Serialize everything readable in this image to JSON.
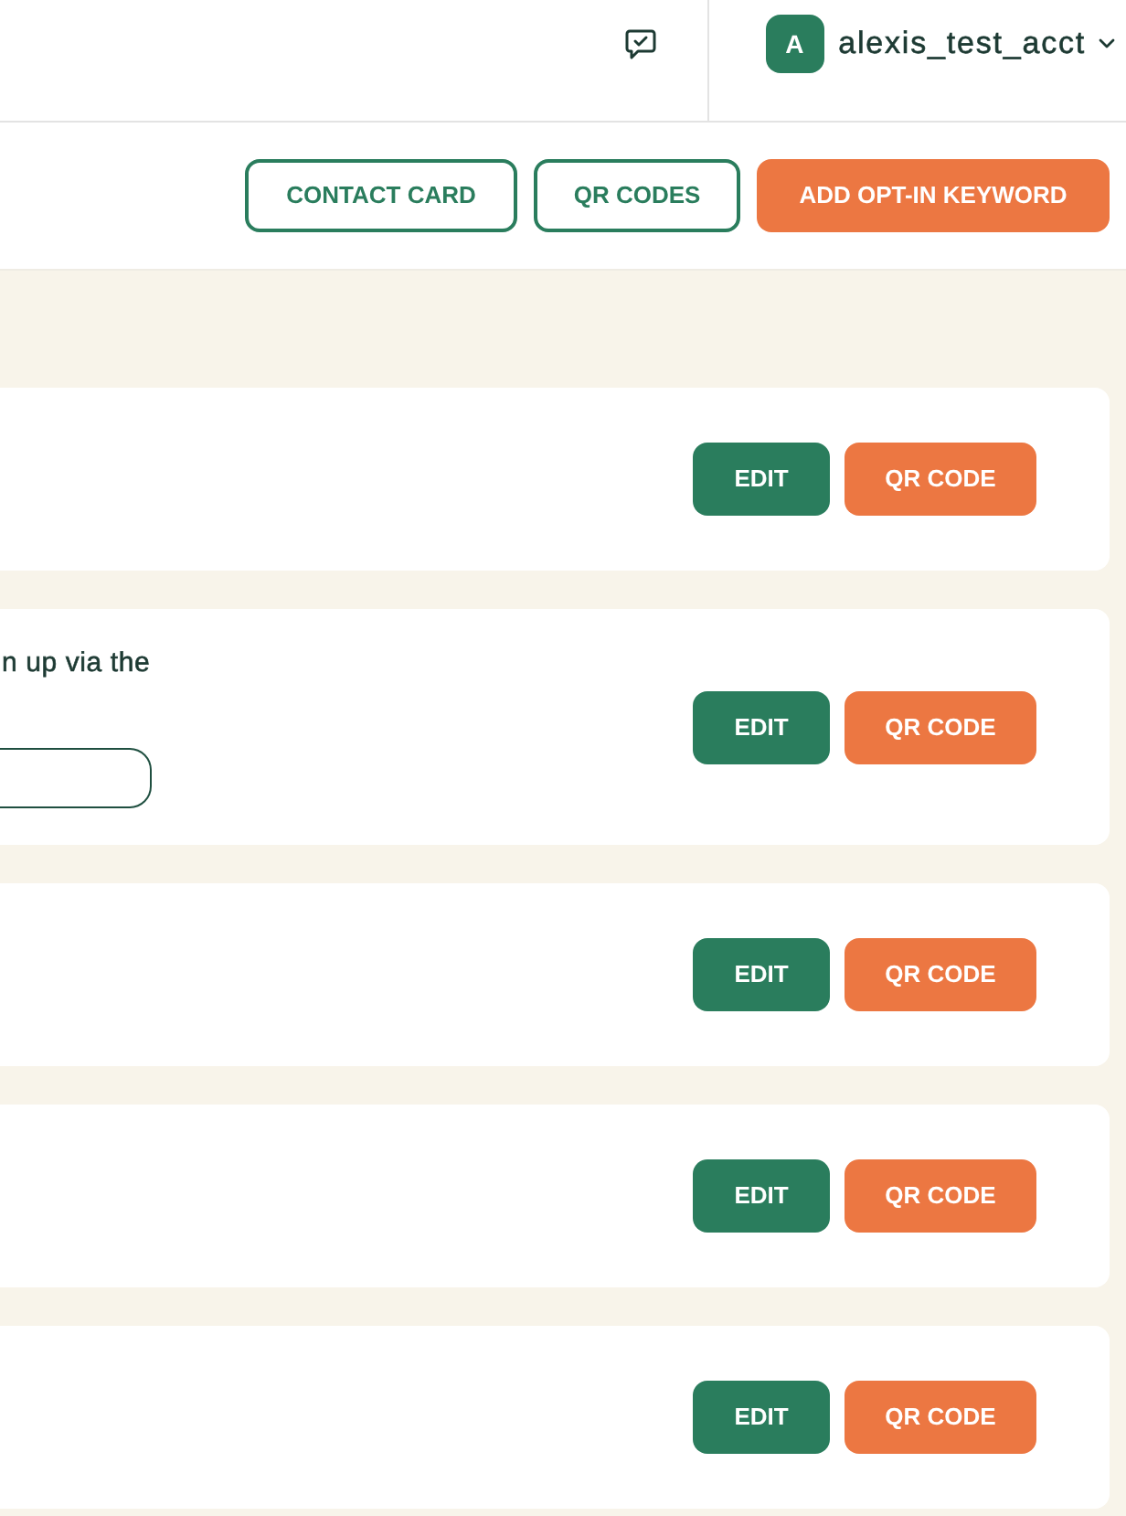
{
  "header": {
    "account": {
      "avatar_letter": "A",
      "username": "alexis_test_acct"
    }
  },
  "toolbar": {
    "buttons": [
      {
        "label": "CONTACT CARD",
        "kind": "outline"
      },
      {
        "label": "QR CODES",
        "kind": "outline"
      },
      {
        "label": "ADD OPT-IN KEYWORD",
        "kind": "primary"
      }
    ]
  },
  "keyword_cards": [
    {
      "kind": "basic",
      "buttons": [
        {
          "label": "EDIT",
          "kind": "edit"
        },
        {
          "label": "QR CODE",
          "kind": "qr"
        }
      ]
    },
    {
      "kind": "detail",
      "text": "n up via the",
      "buttons": [
        {
          "label": "EDIT",
          "kind": "edit"
        },
        {
          "label": "QR CODE",
          "kind": "qr"
        }
      ]
    },
    {
      "kind": "basic",
      "buttons": [
        {
          "label": "EDIT",
          "kind": "edit"
        },
        {
          "label": "QR CODE",
          "kind": "qr"
        }
      ]
    },
    {
      "kind": "basic",
      "buttons": [
        {
          "label": "EDIT",
          "kind": "edit"
        },
        {
          "label": "QR CODE",
          "kind": "qr"
        }
      ]
    },
    {
      "kind": "basic",
      "buttons": [
        {
          "label": "EDIT",
          "kind": "edit"
        },
        {
          "label": "QR CODE",
          "kind": "qr"
        }
      ]
    }
  ]
}
